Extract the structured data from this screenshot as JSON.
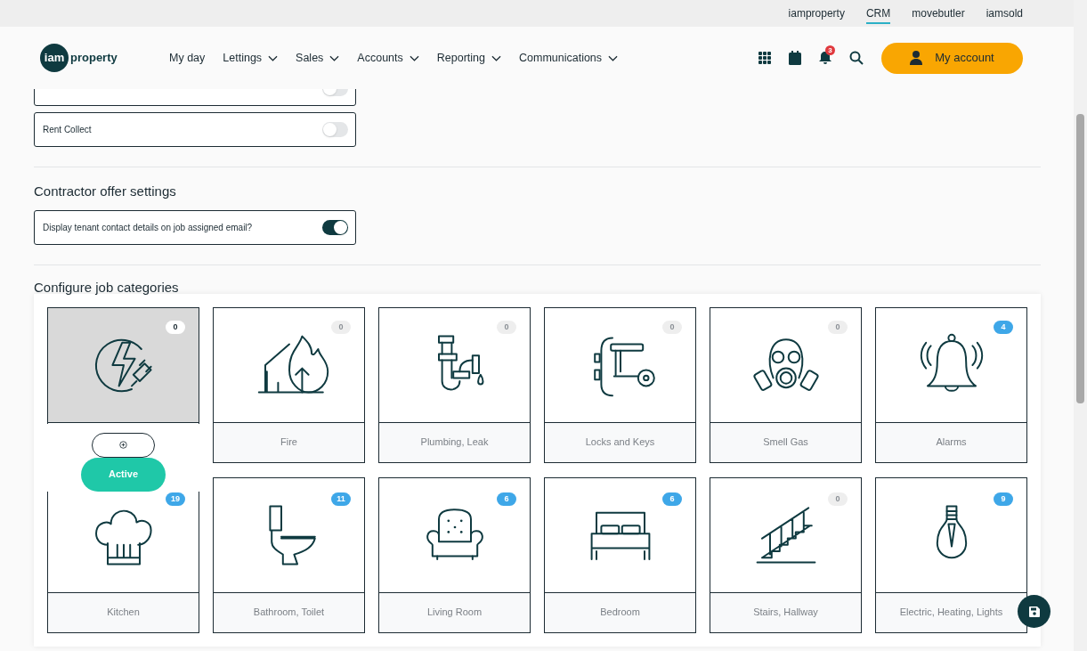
{
  "top_links": [
    {
      "label": "iamproperty",
      "selected": false
    },
    {
      "label": "CRM",
      "selected": true
    },
    {
      "label": "movebutler",
      "selected": false
    },
    {
      "label": "iamsold",
      "selected": false
    }
  ],
  "logo": {
    "badge": "iam",
    "text": "property"
  },
  "nav": [
    {
      "label": "My day",
      "has_menu": false
    },
    {
      "label": "Lettings",
      "has_menu": true
    },
    {
      "label": "Sales",
      "has_menu": true
    },
    {
      "label": "Accounts",
      "has_menu": true
    },
    {
      "label": "Reporting",
      "has_menu": true
    },
    {
      "label": "Communications",
      "has_menu": true
    }
  ],
  "notifications": "3",
  "account_button": "My account",
  "toggles": [
    {
      "on": false
    },
    {
      "label": "Rent Collect",
      "on": false
    }
  ],
  "contractor": {
    "title": "Contractor offer settings",
    "toggles": [
      {
        "label": "Display tenant contact details on job assigned email?",
        "on": true
      }
    ]
  },
  "categories": {
    "title": "Configure job categories",
    "items": [
      {
        "count": "0",
        "has_jobs": false,
        "hovered": true,
        "action": "Active"
      },
      {
        "label": "Fire",
        "count": "0",
        "has_jobs": false,
        "hovered": false
      },
      {
        "label": "Plumbing, Leak",
        "count": "0",
        "has_jobs": false,
        "hovered": false
      },
      {
        "label": "Locks and Keys",
        "count": "0",
        "has_jobs": false,
        "hovered": false
      },
      {
        "label": "Smell Gas",
        "count": "0",
        "has_jobs": false,
        "hovered": false
      },
      {
        "label": "Alarms",
        "count": "4",
        "has_jobs": true,
        "hovered": false
      },
      {
        "label": "Kitchen",
        "count": "19",
        "has_jobs": true,
        "hovered": false
      },
      {
        "label": "Bathroom, Toilet",
        "count": "11",
        "has_jobs": true,
        "hovered": false
      },
      {
        "label": "Living Room",
        "count": "6",
        "has_jobs": true,
        "hovered": false
      },
      {
        "label": "Bedroom",
        "count": "6",
        "has_jobs": true,
        "hovered": false
      },
      {
        "label": "Stairs, Hallway",
        "count": "0",
        "has_jobs": false,
        "hovered": false
      },
      {
        "label": "Electric, Heating, Lights",
        "count": "9",
        "has_jobs": true,
        "hovered": false
      }
    ]
  }
}
